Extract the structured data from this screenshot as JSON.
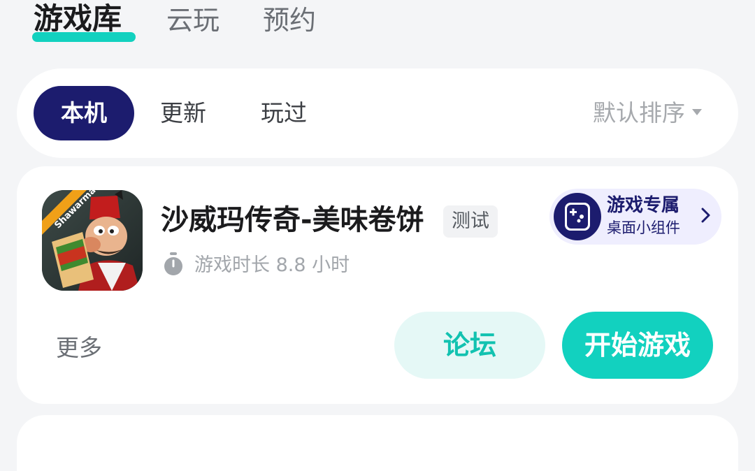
{
  "top_tabs": [
    {
      "label": "游戏库",
      "active": true
    },
    {
      "label": "云玩",
      "active": false
    },
    {
      "label": "预约",
      "active": false
    }
  ],
  "filters": {
    "chips": [
      {
        "label": "本机",
        "active": true
      },
      {
        "label": "更新",
        "active": false
      },
      {
        "label": "玩过",
        "active": false
      }
    ],
    "sort_label": "默认排序"
  },
  "game": {
    "title": "沙威玛传奇-美味卷饼",
    "badge": "测试",
    "icon_text": "Shawarma",
    "playtime": "游戏时长 8.8 小时",
    "widget": {
      "title": "游戏专属",
      "subtitle": "桌面小组件"
    },
    "more_label": "更多",
    "forum_label": "论坛",
    "play_label": "开始游戏"
  },
  "colors": {
    "accent": "#12d1bf",
    "navy": "#1c1c6e"
  }
}
